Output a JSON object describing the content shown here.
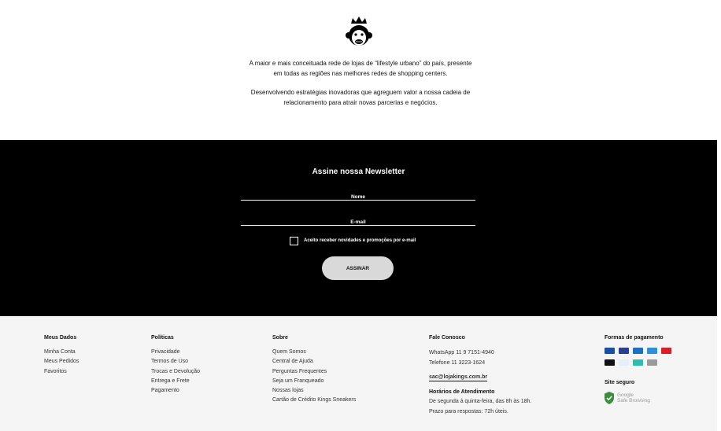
{
  "about": {
    "logo_icon": "crowned-monkey-logo-icon",
    "paragraph1_line1": "A maior e mais conceituada rede de lojas de “lifestyle urbano” do país, presente",
    "paragraph1_line2": "em todas as regiões nas melhores redes de shopping centers.",
    "paragraph2_line1": "Desenvolvendo estratégias inovadoras que agreguem valor a nossa cadeia de",
    "paragraph2_line2": "relacionamento para atrair novas parcerias e negócios."
  },
  "newsletter": {
    "title": "Assine nossa Newsletter",
    "name_placeholder": "Nome",
    "email_placeholder": "E-mail",
    "consent_label": "Aceito receber novidades e promoções por e-mail",
    "consent_checked": false,
    "submit_label": "ASSINAR"
  },
  "footer": {
    "meus_dados": {
      "title": "Meus Dados",
      "links": [
        "Minha Conta",
        "Meus Pedidos",
        "Favoritos"
      ]
    },
    "politicas": {
      "title": "Políticas",
      "links": [
        "Privacidade",
        "Termos de Uso",
        "Trocas e Devolução",
        "Entrega e Frete",
        "Pagamento"
      ]
    },
    "sobre": {
      "title": "Sobre",
      "links": [
        "Quem Somos",
        "Central de Ajuda",
        "Perguntas Frequentes",
        "Seja um Franqueado",
        "Nossas lojas",
        "Cartão de Crédito Kings Sneakers"
      ]
    },
    "fale_conosco": {
      "title": "Fale Conosco",
      "whatsapp": "WhatsApp 11 9 7151-4940",
      "telefone": "Telefone 11 3223-1624",
      "email": "sac@lojakings.com.br",
      "hours_title": "Horários de Atendimento",
      "hours_line1": "De segunda à quinta-feira, das 8h às 18h.",
      "hours_line2": "Prazo para respostas: 72h úteis."
    },
    "pagamento": {
      "title": "Formas de pagamento",
      "cards": [
        {
          "icon": "visa-card-icon",
          "color": "#1a4fa0"
        },
        {
          "icon": "mastercard-card-icon",
          "color": "#2a3f8f"
        },
        {
          "icon": "diners-card-icon",
          "color": "#1f6fc0"
        },
        {
          "icon": "amex-card-icon",
          "color": "#2f8fd8"
        },
        {
          "icon": "hipercard-card-icon",
          "color": "#d61f26"
        },
        {
          "icon": "elo-card-icon",
          "color": "#111111"
        },
        {
          "icon": "paypal-card-icon",
          "color": "#e8eef8"
        },
        {
          "icon": "pix-card-icon",
          "color": "#32bcad"
        },
        {
          "icon": "boleto-card-icon",
          "color": "#9a9a9a"
        }
      ]
    },
    "site_seguro": {
      "title": "Site seguro",
      "badge_line1": "Google",
      "badge_line2": "Safe Browsing",
      "badge_icon": "shield-check-icon",
      "badge_color": "#3d8b3d"
    }
  }
}
